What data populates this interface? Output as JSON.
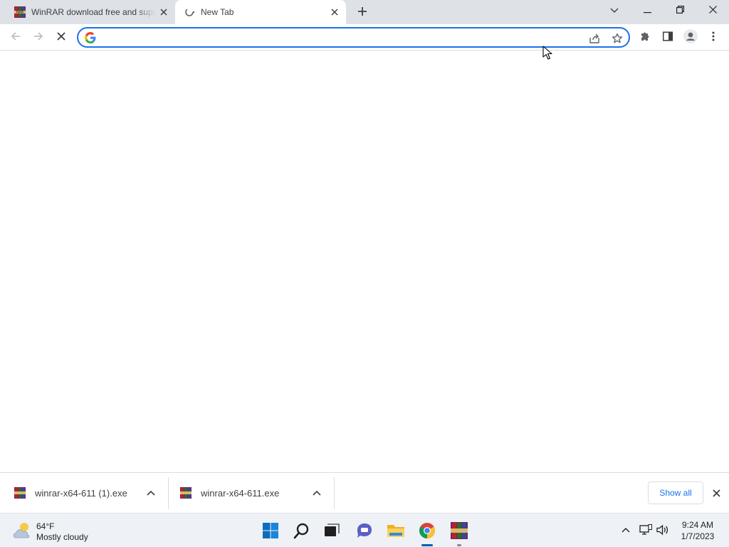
{
  "browser": {
    "tabs": [
      {
        "title": "WinRAR download free and support: WinRAR",
        "active": false,
        "favicon": "winrar-icon"
      },
      {
        "title": "New Tab",
        "active": true,
        "favicon": "chrome-loading-icon"
      }
    ],
    "omnibox": {
      "value": "",
      "placeholder": ""
    }
  },
  "downloads": {
    "items": [
      {
        "filename": "winrar-x64-611 (1).exe"
      },
      {
        "filename": "winrar-x64-611.exe"
      }
    ],
    "show_all_label": "Show all"
  },
  "taskbar": {
    "weather": {
      "temp": "64°F",
      "condition": "Mostly cloudy"
    },
    "pinned": [
      "windows-start-icon",
      "search-icon",
      "task-view-icon",
      "teams-chat-icon",
      "file-explorer-icon",
      "chrome-icon",
      "winrar-icon"
    ],
    "clock": {
      "time": "9:24 AM",
      "date": "1/7/2023"
    }
  },
  "colors": {
    "accent": "#1a73e8",
    "tabstrip": "#dee1e6",
    "taskbar": "#eef1f6",
    "taskbar_active": "#005fb8"
  }
}
